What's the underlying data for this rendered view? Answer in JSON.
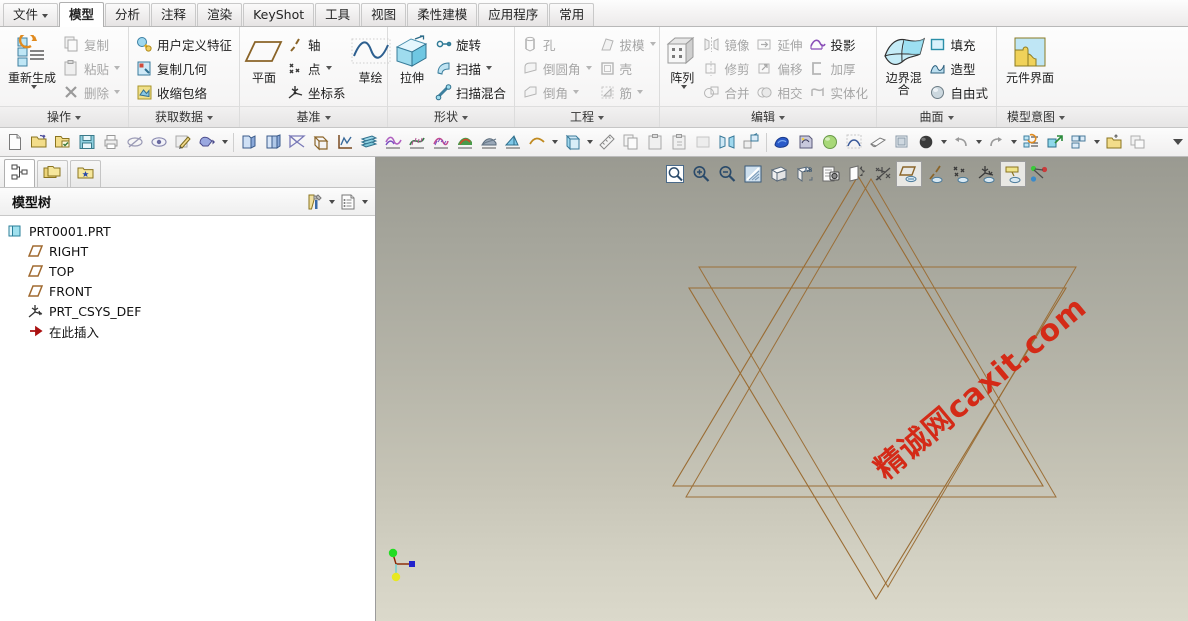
{
  "app": {
    "tabs": [
      {
        "label": "文件",
        "has_caret": true,
        "active": false
      },
      {
        "label": "模型",
        "has_caret": false,
        "active": true
      },
      {
        "label": "分析",
        "has_caret": false,
        "active": false
      },
      {
        "label": "注释",
        "has_caret": false,
        "active": false
      },
      {
        "label": "渲染",
        "has_caret": false,
        "active": false
      },
      {
        "label": "KeyShot",
        "has_caret": false,
        "active": false
      },
      {
        "label": "工具",
        "has_caret": false,
        "active": false
      },
      {
        "label": "视图",
        "has_caret": false,
        "active": false
      },
      {
        "label": "柔性建模",
        "has_caret": false,
        "active": false
      },
      {
        "label": "应用程序",
        "has_caret": false,
        "active": false
      },
      {
        "label": "常用",
        "has_caret": false,
        "active": false
      }
    ]
  },
  "ribbon": {
    "groups": [
      {
        "title": "操作",
        "big": {
          "label": "重新生成",
          "icon": "regenerate-icon",
          "caret": true
        },
        "items": [
          {
            "label": "复制",
            "icon": "copy-icon",
            "caret": false,
            "disabled": true
          },
          {
            "label": "粘贴",
            "icon": "paste-icon",
            "caret": true,
            "disabled": true
          },
          {
            "label": "删除",
            "icon": "delete-icon",
            "caret": true,
            "disabled": true
          }
        ]
      },
      {
        "title": "获取数据",
        "items": [
          {
            "label": "用户定义特征",
            "icon": "udf-icon",
            "caret": false,
            "disabled": false
          },
          {
            "label": "复制几何",
            "icon": "copy-geometry-icon",
            "caret": false,
            "disabled": false
          },
          {
            "label": "收缩包络",
            "icon": "shrinkwrap-icon",
            "caret": false,
            "disabled": false
          }
        ]
      },
      {
        "title": "基准",
        "big": {
          "label": "平面",
          "icon": "datum-plane-icon",
          "caret": false
        },
        "items": [
          {
            "label": "轴",
            "icon": "datum-axis-icon",
            "caret": false,
            "disabled": false
          },
          {
            "label": "点",
            "icon": "datum-point-icon",
            "caret": true,
            "disabled": false
          },
          {
            "label": "坐标系",
            "icon": "coordinate-system-icon",
            "caret": false,
            "disabled": false
          }
        ],
        "big2": {
          "label": "草绘",
          "icon": "sketch-icon",
          "caret": false
        }
      },
      {
        "title": "形状",
        "big": {
          "label": "拉伸",
          "icon": "extrude-icon",
          "caret": false
        },
        "items": [
          {
            "label": "旋转",
            "icon": "revolve-icon",
            "caret": false,
            "disabled": false
          },
          {
            "label": "扫描",
            "icon": "sweep-icon",
            "caret": true,
            "disabled": false
          },
          {
            "label": "扫描混合",
            "icon": "swept-blend-icon",
            "caret": false,
            "disabled": false
          }
        ]
      },
      {
        "title": "工程",
        "items": [
          {
            "label": "孔",
            "icon": "hole-icon",
            "caret": false,
            "disabled": true
          },
          {
            "label": "倒圆角",
            "icon": "round-icon",
            "caret": true,
            "disabled": true
          },
          {
            "label": "倒角",
            "icon": "chamfer-icon",
            "caret": true,
            "disabled": true
          }
        ],
        "items2": [
          {
            "label": "拔模",
            "icon": "draft-icon",
            "caret": true,
            "disabled": true
          },
          {
            "label": "壳",
            "icon": "shell-icon",
            "caret": false,
            "disabled": true
          },
          {
            "label": "筋",
            "icon": "rib-icon",
            "caret": true,
            "disabled": true
          }
        ]
      },
      {
        "title": "编辑",
        "big": {
          "label": "阵列",
          "icon": "pattern-icon",
          "caret": true
        },
        "items": [
          {
            "label": "镜像",
            "icon": "mirror-icon",
            "caret": false,
            "disabled": true
          },
          {
            "label": "修剪",
            "icon": "trim-icon",
            "caret": false,
            "disabled": true
          },
          {
            "label": "合并",
            "icon": "merge-icon",
            "caret": false,
            "disabled": true
          }
        ],
        "items2": [
          {
            "label": "延伸",
            "icon": "extend-icon",
            "caret": false,
            "disabled": true
          },
          {
            "label": "偏移",
            "icon": "offset-icon",
            "caret": false,
            "disabled": true
          },
          {
            "label": "相交",
            "icon": "intersect-icon",
            "caret": false,
            "disabled": true
          }
        ],
        "items3": [
          {
            "label": "投影",
            "icon": "project-icon",
            "caret": false,
            "disabled": false
          },
          {
            "label": "加厚",
            "icon": "thicken-icon",
            "caret": false,
            "disabled": true
          },
          {
            "label": "实体化",
            "icon": "solidify-icon",
            "caret": false,
            "disabled": true
          }
        ]
      },
      {
        "title": "曲面",
        "big": {
          "label": "边界混合",
          "icon": "boundary-blend-icon",
          "caret": false
        },
        "items": [
          {
            "label": "填充",
            "icon": "fill-icon",
            "caret": false,
            "disabled": false
          },
          {
            "label": "造型",
            "icon": "style-icon",
            "caret": false,
            "disabled": false
          },
          {
            "label": "自由式",
            "icon": "freestyle-icon",
            "caret": false,
            "disabled": false
          }
        ]
      },
      {
        "title": "模型意图",
        "big": {
          "label": "元件界面",
          "icon": "component-interface-icon",
          "caret": false
        }
      }
    ]
  },
  "quickbar": {
    "items": [
      {
        "icon": "new-file-icon"
      },
      {
        "icon": "open-folder-icon"
      },
      {
        "icon": "set-working-dir-icon"
      },
      {
        "icon": "save-icon"
      },
      {
        "icon": "print-icon"
      },
      {
        "icon": "hide-icon"
      },
      {
        "icon": "show-icon"
      },
      {
        "icon": "annotate-icon"
      },
      {
        "icon": "paint-icon",
        "caret": true
      },
      {
        "sep": true
      },
      {
        "icon": "view-manager-icon"
      },
      {
        "icon": "layers-icon"
      },
      {
        "icon": "plane-display-icon"
      },
      {
        "icon": "csys-display-icon"
      },
      {
        "icon": "graph-icon"
      },
      {
        "icon": "datum-display-icon"
      },
      {
        "icon": "curve-analysis-icon"
      },
      {
        "icon": "curvature-icon"
      },
      {
        "icon": "section-icon"
      },
      {
        "icon": "reflection-icon"
      },
      {
        "icon": "gaussian-icon"
      },
      {
        "icon": "slope-icon"
      },
      {
        "icon": "draft-analysis-icon"
      },
      {
        "icon": "curve-tool-icon",
        "caret": true
      },
      {
        "sep": true
      },
      {
        "icon": "plane-tool-icon",
        "caret": true
      },
      {
        "icon": "measure-icon"
      },
      {
        "icon": "copy2-icon"
      },
      {
        "icon": "paste2-icon"
      },
      {
        "icon": "paste-special-icon"
      },
      {
        "icon": "blank-icon"
      },
      {
        "icon": "mirror2-icon"
      },
      {
        "icon": "reorder-icon"
      },
      {
        "sep": true
      },
      {
        "icon": "appearance-icon"
      },
      {
        "icon": "render-icon"
      },
      {
        "icon": "sphere-light-icon"
      },
      {
        "icon": "perspective-icon"
      },
      {
        "icon": "shading-icon"
      },
      {
        "icon": "display-style-icon"
      },
      {
        "icon": "shaded-icon",
        "caret": true
      },
      {
        "sep": true
      },
      {
        "icon": "undo-icon",
        "caret": true
      },
      {
        "icon": "redo-icon",
        "caret": true
      },
      {
        "sep": true
      },
      {
        "icon": "regen2-icon"
      },
      {
        "icon": "move-icon"
      },
      {
        "icon": "window-icon",
        "caret": true
      },
      {
        "icon": "open-window-icon"
      },
      {
        "icon": "close-window-icon"
      }
    ],
    "overflow_icon": "chevron-down-icon"
  },
  "tree_panel": {
    "nav_tabs": [
      {
        "icon": "model-tree-icon",
        "active": true
      },
      {
        "icon": "folder-browser-icon",
        "active": false
      },
      {
        "icon": "favorites-icon",
        "active": false
      }
    ],
    "title": "模型树",
    "tools": [
      {
        "icon": "tree-filter-icon",
        "caret": true
      },
      {
        "icon": "tree-settings-icon",
        "caret": true
      }
    ],
    "nodes": [
      {
        "label": "PRT0001.PRT",
        "icon": "part-icon",
        "indent": 0
      },
      {
        "label": "RIGHT",
        "icon": "datum-plane-tree-icon",
        "indent": 1
      },
      {
        "label": "TOP",
        "icon": "datum-plane-tree-icon",
        "indent": 1
      },
      {
        "label": "FRONT",
        "icon": "datum-plane-tree-icon",
        "indent": 1
      },
      {
        "label": "PRT_CSYS_DEF",
        "icon": "csys-tree-icon",
        "indent": 1
      },
      {
        "label": "在此插入",
        "icon": "insert-here-icon",
        "indent": 1
      }
    ]
  },
  "viewport": {
    "graphics_toolbar": [
      {
        "icon": "zoom-fit-icon",
        "selected": false
      },
      {
        "icon": "zoom-in-icon",
        "selected": false
      },
      {
        "icon": "zoom-out-icon",
        "selected": false
      },
      {
        "icon": "repaint-icon",
        "selected": false
      },
      {
        "icon": "display-style-icon",
        "selected": false
      },
      {
        "icon": "saved-views-icon",
        "selected": false
      },
      {
        "icon": "screenshot-icon",
        "selected": false
      },
      {
        "icon": "perspective-view-icon",
        "selected": false
      },
      {
        "icon": "datum-all-off-icon",
        "selected": false
      },
      {
        "icon": "plane-display-toggle-icon",
        "selected": true
      },
      {
        "icon": "axis-display-toggle-icon",
        "selected": false
      },
      {
        "icon": "point-display-toggle-icon",
        "selected": false
      },
      {
        "icon": "csys-display-toggle-icon",
        "selected": false
      },
      {
        "icon": "annotation-display-toggle-icon",
        "selected": true
      },
      {
        "icon": "spin-center-icon",
        "selected": false
      }
    ],
    "watermark": "精诚网caxit.com",
    "watermark_color": "#d42a17",
    "geometry_color": "#9a6c33",
    "csys": {
      "x_axis_color": "#0000cc",
      "y_axis_color": "#00dd00",
      "z_axis_color": "#dddd00",
      "line_color": "#8b2500"
    }
  }
}
